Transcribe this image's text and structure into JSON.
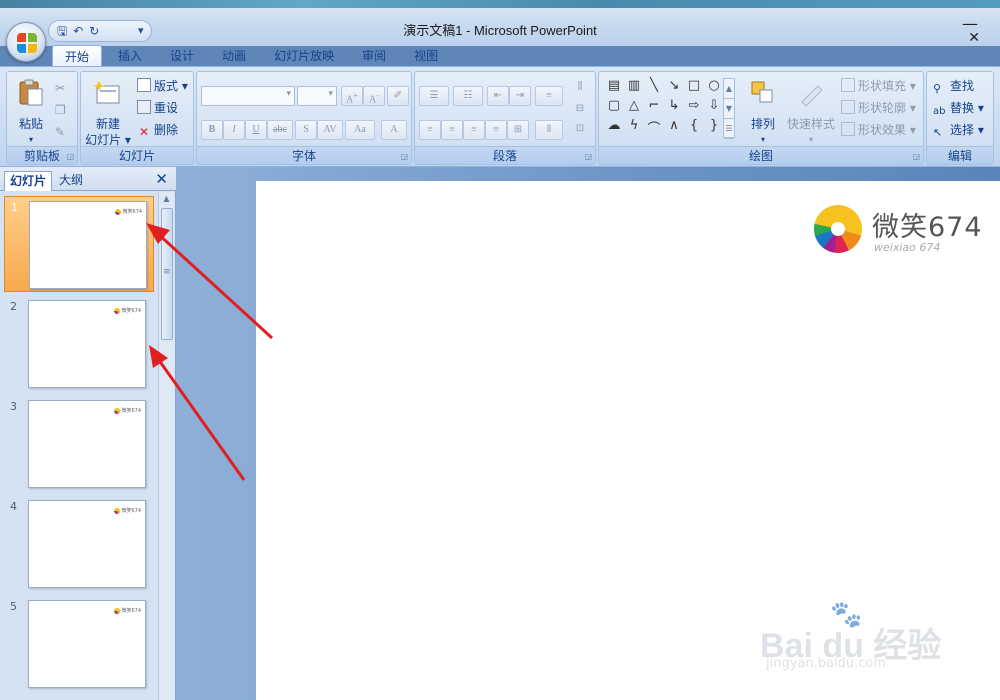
{
  "window": {
    "title": "演示文稿1 - Microsoft PowerPoint",
    "minimize": "—",
    "close": "✕"
  },
  "qat": {
    "save": "🖫",
    "undo": "↶",
    "redo": "↻",
    "more": "▾"
  },
  "tabs": [
    {
      "label": "开始",
      "active": true
    },
    {
      "label": "插入"
    },
    {
      "label": "设计"
    },
    {
      "label": "动画"
    },
    {
      "label": "幻灯片放映"
    },
    {
      "label": "审阅"
    },
    {
      "label": "视图"
    }
  ],
  "ribbon": {
    "clipboard": {
      "label": "剪贴板",
      "paste": "粘贴"
    },
    "slides": {
      "label": "幻灯片",
      "new_slide_line1": "新建",
      "new_slide_line2": "幻灯片 ▾",
      "layout": "版式 ▾",
      "reset": "重设",
      "delete": "删除"
    },
    "font": {
      "label": "字体"
    },
    "paragraph": {
      "label": "段落"
    },
    "drawing": {
      "label": "绘图",
      "arrange": "排列",
      "quick_styles": "快速样式",
      "shape_fill": "形状填充 ▾",
      "shape_outline": "形状轮廓 ▾",
      "shape_effects": "形状效果 ▾"
    },
    "editing": {
      "label": "编辑",
      "find": "查找",
      "replace": "替换 ▾",
      "select": "选择 ▾"
    }
  },
  "panel": {
    "tab_slides": "幻灯片",
    "tab_outline": "大纲",
    "close": "✕",
    "slides": [
      {
        "num": "1",
        "selected": true
      },
      {
        "num": "2"
      },
      {
        "num": "3"
      },
      {
        "num": "4"
      },
      {
        "num": "5"
      }
    ],
    "thumb_brand": "微笑674"
  },
  "slide": {
    "brand": "微笑674",
    "brand_sub": "weixiao 674"
  },
  "watermark": {
    "text": "Bai  du 经验",
    "url": "jingyan.baidu.com"
  },
  "colors": {
    "accent": "#15428b",
    "selected_thumb": "#f7a94d",
    "arrow": "#e02020"
  }
}
